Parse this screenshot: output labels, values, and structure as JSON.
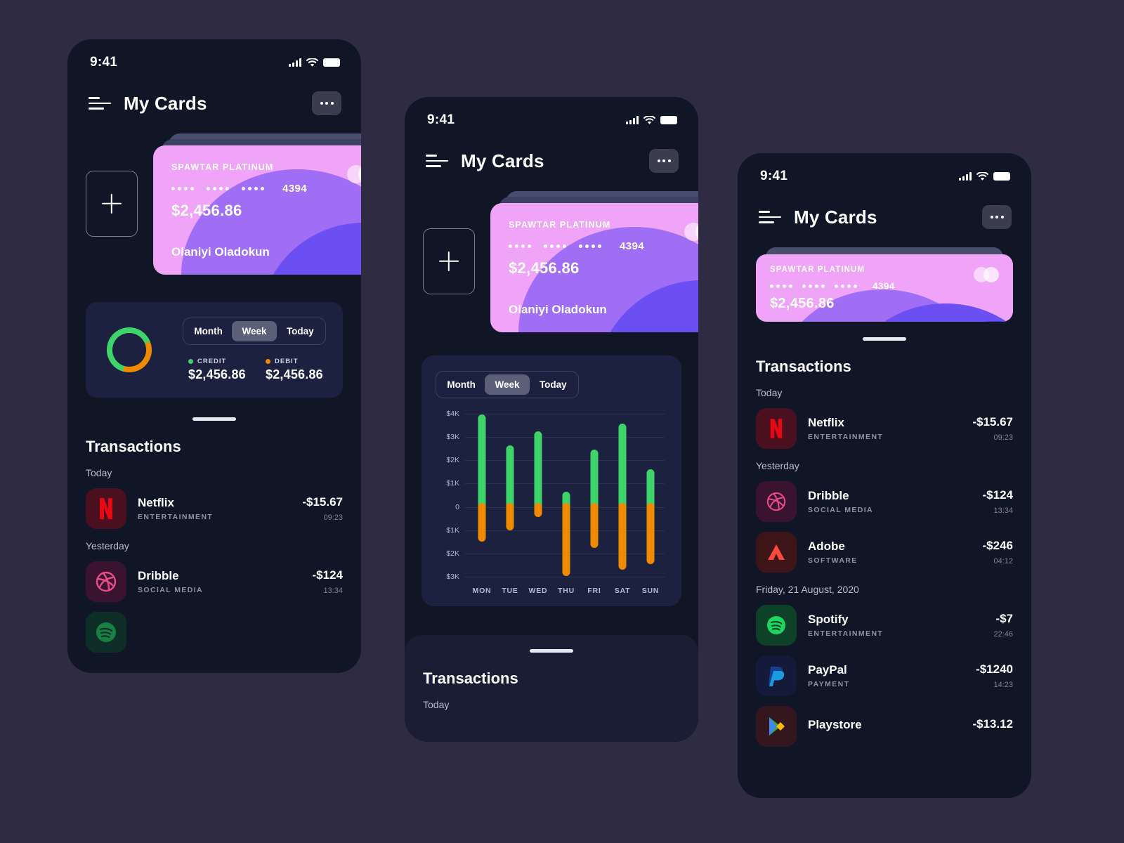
{
  "theme": {
    "page_bg": "#2e2b42",
    "phone_bg": "#111626",
    "panel_bg": "#1d2140",
    "credit_color": "#3fd46a",
    "debit_color": "#f08a00",
    "accent_pink": "#f0a4f7",
    "accent_purple": "#6b4ff2"
  },
  "status_bar": {
    "time": "9:41",
    "signal_icon": "cellular-bars-icon",
    "wifi_icon": "wifi-icon",
    "battery_icon": "battery-icon"
  },
  "header": {
    "menu_icon": "hamburger-menu-icon",
    "title": "My Cards",
    "more_icon": "more-options-icon"
  },
  "card_section": {
    "add_card_icon": "plus-icon",
    "card": {
      "brand": "SPAWTAR PLATINUM",
      "masked_groups": [
        "••••",
        "••••",
        "••••"
      ],
      "last_four": "4394",
      "balance": "$2,456.86",
      "holder": "Olaniyi Oladokun",
      "chip_icon": "mastercard-circles-icon"
    }
  },
  "stats": {
    "segments": [
      {
        "label": "Month",
        "active": false
      },
      {
        "label": "Week",
        "active": true
      },
      {
        "label": "Today",
        "active": false
      }
    ],
    "donut": {
      "credit_percent": 68,
      "debit_percent": 32,
      "credit_color": "#3fd46a",
      "debit_color": "#f08a00"
    },
    "legend": [
      {
        "label": "CREDIT",
        "value": "$2,456.86",
        "color": "#3fd46a"
      },
      {
        "label": "DEBIT",
        "value": "$2,456.86",
        "color": "#f08a00"
      }
    ]
  },
  "chart_data": {
    "type": "bar",
    "title": "",
    "xlabel": "",
    "ylabel": "",
    "categories": [
      "MON",
      "TUE",
      "WED",
      "THU",
      "FRI",
      "SAT",
      "SUN"
    ],
    "ytick_labels": [
      "$4K",
      "$3K",
      "$2K",
      "$1K",
      "0",
      "$1K",
      "$2K",
      "$3K"
    ],
    "ytick_values": [
      4000,
      3000,
      2000,
      1000,
      0,
      -1000,
      -2000,
      -3000
    ],
    "ylim": [
      -3000,
      4000
    ],
    "grid": true,
    "legend_position": "none",
    "series": [
      {
        "name": "Credit",
        "color": "#3fd46a",
        "values": [
          3960,
          2630,
          3240,
          660,
          2460,
          3590,
          1630
        ]
      },
      {
        "name": "Debit",
        "color": "#f08a00",
        "values": [
          -1480,
          -1010,
          -440,
          -2970,
          -1760,
          -2710,
          -2450
        ]
      }
    ]
  },
  "transactions": {
    "title": "Transactions",
    "drag_handle_icon": "drag-handle-icon",
    "groups": [
      {
        "label": "Today",
        "items": [
          {
            "name": "Netflix",
            "category": "ENTERTAINMENT",
            "amount": "-$15.67",
            "time": "09:23",
            "icon": "netflix-icon",
            "icon_bg": "#4a1020",
            "icon_fg": "#e50914"
          }
        ]
      },
      {
        "label": "Yesterday",
        "items": [
          {
            "name": "Dribble",
            "category": "SOCIAL MEDIA",
            "amount": "-$124",
            "time": "13:34",
            "icon": "dribbble-icon",
            "icon_bg": "#3a1330",
            "icon_fg": "#ea4c89"
          },
          {
            "name": "Adobe",
            "category": "SOFTWARE",
            "amount": "-$246",
            "time": "04:12",
            "icon": "adobe-icon",
            "icon_bg": "#3d1418",
            "icon_fg": "#fa4a3c"
          }
        ]
      },
      {
        "label": "Friday, 21 August, 2020",
        "items": [
          {
            "name": "Spotify",
            "category": "ENTERTAINMENT",
            "amount": "-$7",
            "time": "22:46",
            "icon": "spotify-icon",
            "icon_bg": "#0e4228",
            "icon_fg": "#1ed760"
          },
          {
            "name": "PayPal",
            "category": "PAYMENT",
            "amount": "-$1240",
            "time": "14:23",
            "icon": "paypal-icon",
            "icon_bg": "#141a3a",
            "icon_fg": "#1b5fd9"
          },
          {
            "name": "Playstore",
            "category": "",
            "amount": "-$13.12",
            "time": "",
            "icon": "google-play-icon",
            "icon_bg": "#34161f",
            "icon_fg": "#34a853"
          }
        ]
      }
    ]
  }
}
